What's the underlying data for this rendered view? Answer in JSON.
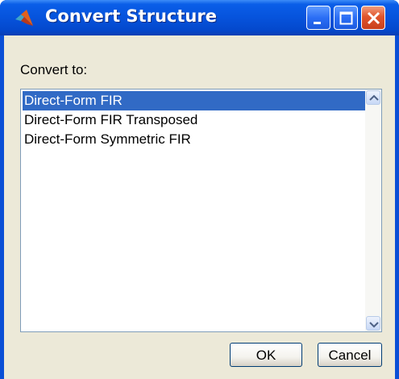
{
  "window": {
    "title": "Convert Structure",
    "titlebar_color": "#0653dc",
    "icons": [
      "matlab-logo-icon",
      "minimize-icon",
      "maximize-icon",
      "close-icon"
    ]
  },
  "convert_label": "Convert to:",
  "structures": {
    "items": [
      "Direct-Form FIR",
      "Direct-Form FIR Transposed",
      "Direct-Form Symmetric FIR"
    ],
    "selected": "Direct-Form FIR",
    "selected_color": "#316ac5"
  },
  "buttons": {
    "ok": "OK",
    "cancel": "Cancel"
  }
}
